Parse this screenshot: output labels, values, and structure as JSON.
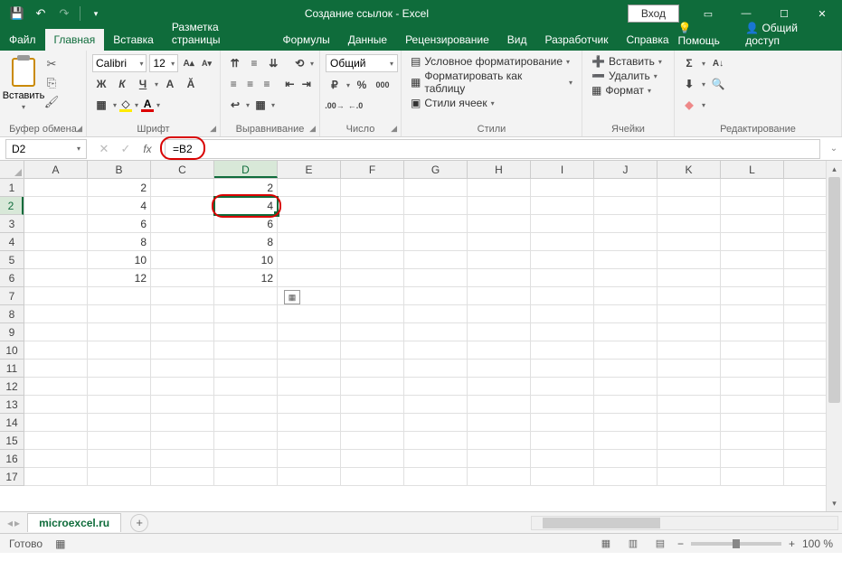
{
  "titlebar": {
    "title": "Создание ссылок  -  Excel",
    "login": "Вход"
  },
  "tabs": {
    "file": "Файл",
    "home": "Главная",
    "insert": "Вставка",
    "layout": "Разметка страницы",
    "formulas": "Формулы",
    "data": "Данные",
    "review": "Рецензирование",
    "view": "Вид",
    "developer": "Разработчик",
    "help": "Справка",
    "tell": "Помощь",
    "share": "Общий доступ"
  },
  "ribbon": {
    "clipboard": {
      "label": "Буфер обмена",
      "paste": "Вставить"
    },
    "font": {
      "label": "Шрифт",
      "name": "Calibri",
      "size": "12"
    },
    "align": {
      "label": "Выравнивание"
    },
    "number": {
      "label": "Число",
      "format": "Общий"
    },
    "styles": {
      "label": "Стили",
      "cond": "Условное форматирование",
      "table": "Форматировать как таблицу",
      "cell": "Стили ячеек"
    },
    "cells": {
      "label": "Ячейки",
      "insert": "Вставить",
      "delete": "Удалить",
      "format": "Формат"
    },
    "editing": {
      "label": "Редактирование"
    }
  },
  "formula_bar": {
    "name_box": "D2",
    "formula": "=B2"
  },
  "grid": {
    "cols": [
      "A",
      "B",
      "C",
      "D",
      "E",
      "F",
      "G",
      "H",
      "I",
      "J",
      "K",
      "L"
    ],
    "rows": [
      "1",
      "2",
      "3",
      "4",
      "5",
      "6",
      "7",
      "8",
      "9",
      "10",
      "11",
      "12",
      "13",
      "14",
      "15",
      "16",
      "17"
    ],
    "selected_col": "D",
    "selected_row": "2",
    "data_b": [
      "2",
      "4",
      "6",
      "8",
      "10",
      "12"
    ],
    "data_d": [
      "2",
      "4",
      "6",
      "8",
      "10",
      "12"
    ]
  },
  "sheet": {
    "name": "microexcel.ru"
  },
  "status": {
    "ready": "Готово",
    "zoom": "100 %"
  }
}
